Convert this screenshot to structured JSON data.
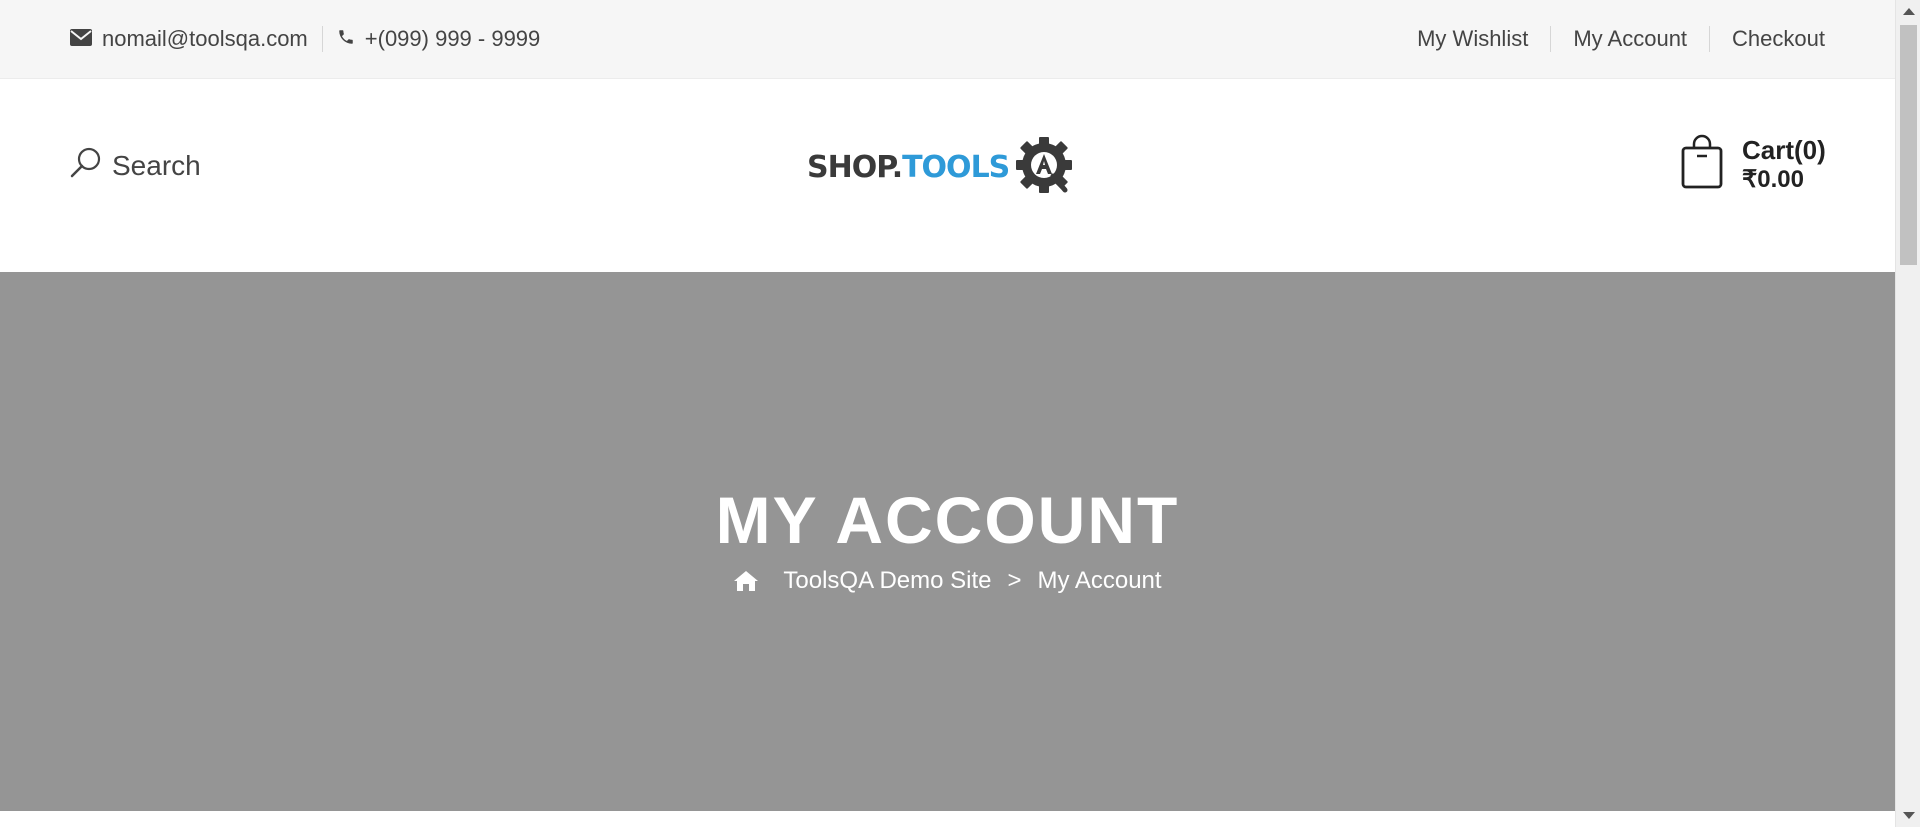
{
  "topbar": {
    "email": "nomail@toolsqa.com",
    "phone": "+(099) 999 - 9999",
    "links": {
      "wishlist": "My Wishlist",
      "account": "My Account",
      "checkout": "Checkout"
    },
    "icons": {
      "email": "envelope-icon",
      "phone": "phone-icon"
    }
  },
  "header": {
    "search_label": "Search",
    "logo": {
      "part1": "SHOP.",
      "part2": "TOOLS",
      "emblem_letter": "A"
    },
    "cart": {
      "label": "Cart(0)",
      "total": "₹0.00"
    },
    "icons": {
      "search": "search-icon",
      "cart": "shopping-bag-icon"
    }
  },
  "hero": {
    "title": "MY ACCOUNT",
    "breadcrumb": {
      "home": "ToolsQA Demo Site",
      "separator": ">",
      "current": "My Account"
    },
    "icons": {
      "home": "home-icon"
    }
  },
  "colors": {
    "topbar_bg": "#f6f6f6",
    "hero_bg": "#959595",
    "logo_blue": "#2e9ad8",
    "text_dark": "#444444"
  }
}
